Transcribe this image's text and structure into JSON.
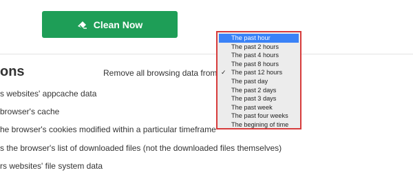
{
  "clean_button": {
    "label": "Clean Now",
    "icon": "eraser-icon"
  },
  "section": {
    "title": "ons"
  },
  "remove_label": "Remove all browsing data from",
  "options": [
    "s websites' appcache data",
    "browser's cache",
    "he browser's cookies modified within a particular timeframe",
    "s the browser's list of downloaded files (not the downloaded files themselves)",
    "rs websites' file system data"
  ],
  "dropdown": {
    "items": [
      "The past hour",
      "The past 2 hours",
      "The past 4 hours",
      "The past 8 hours",
      "The past 12 hours",
      "The past day",
      "The past 2 days",
      "The past 3 days",
      "The past week",
      "The past four weeks",
      "The begining of time"
    ],
    "highlighted": "The past hour",
    "checked": "The past 12 hours",
    "check_glyph": "✓"
  },
  "colors": {
    "button_green": "#1e9e57",
    "highlight_blue": "#3a82f7",
    "dropdown_border": "#d63a3a"
  }
}
